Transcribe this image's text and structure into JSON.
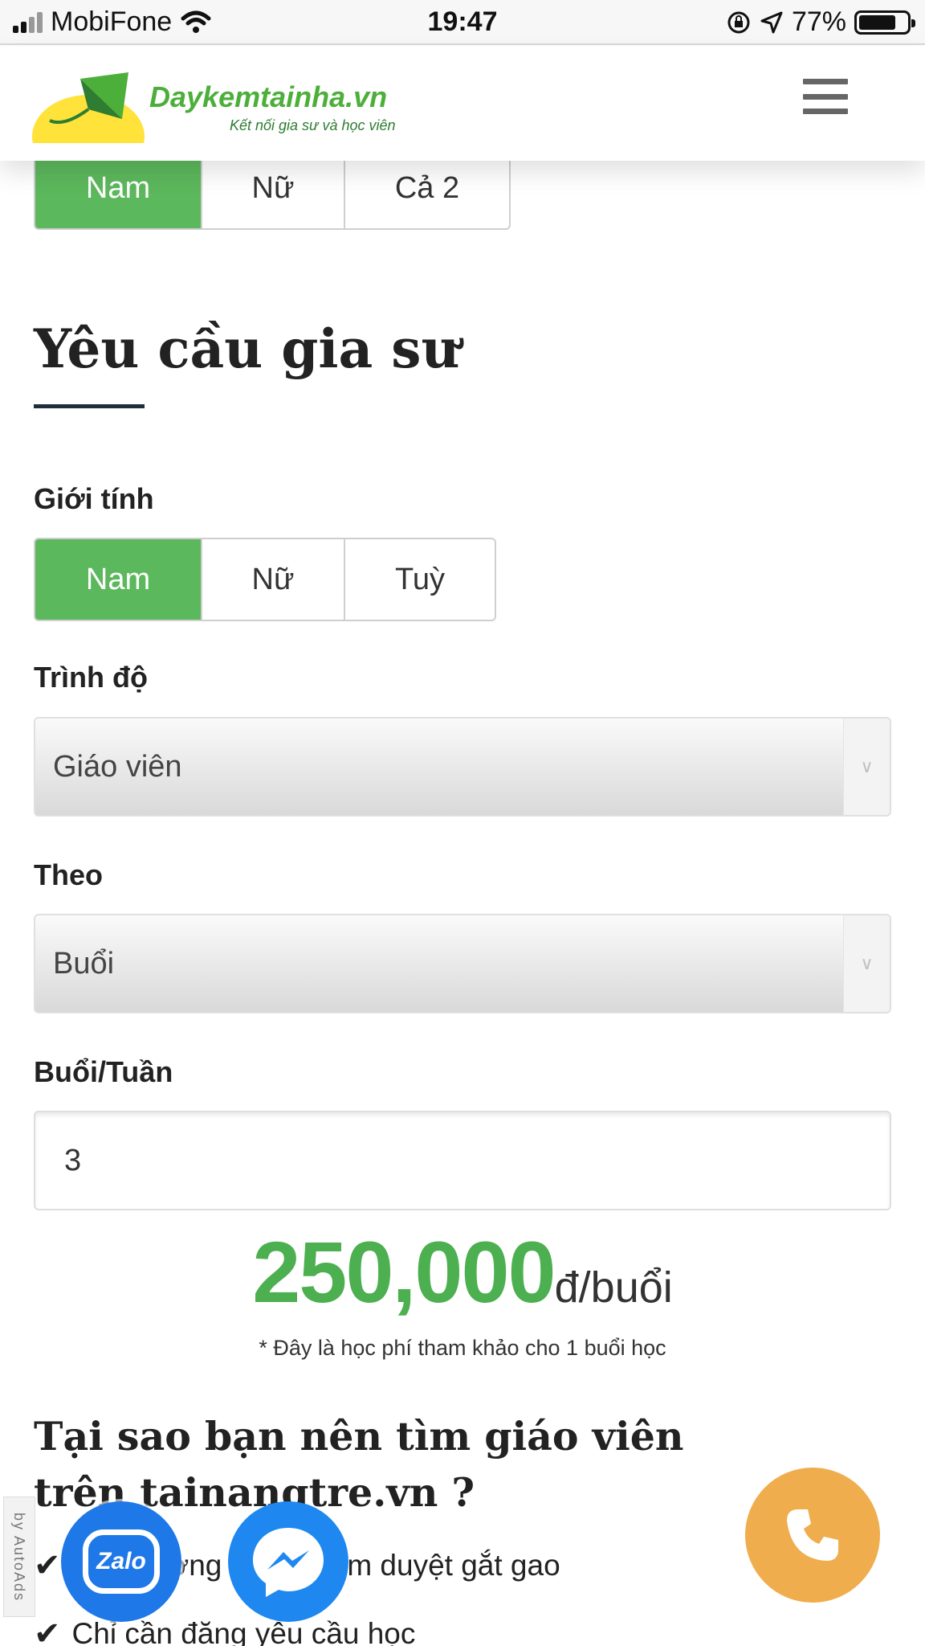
{
  "status_bar": {
    "carrier": "MobiFone",
    "time": "19:47",
    "battery": "77%",
    "battery_level": 0.77
  },
  "header": {
    "logo_title": "Daykemtainha.vn",
    "logo_subtitle": "Kết nối gia sư và học viên",
    "menu_icon": "hamburger-icon"
  },
  "gender_top": {
    "options": [
      "Nam",
      "Nữ",
      "Cả 2"
    ],
    "selected": "Nam"
  },
  "section": {
    "title": "Yêu cầu gia sư"
  },
  "gender": {
    "label": "Giới tính",
    "options": [
      "Nam",
      "Nữ",
      "Tuỳ"
    ],
    "selected": "Nam"
  },
  "level": {
    "label": "Trình độ",
    "value": "Giáo viên"
  },
  "by": {
    "label": "Theo",
    "value": "Buổi"
  },
  "sessions": {
    "label": "Buổi/Tuần",
    "value": "3"
  },
  "price": {
    "amount": "250,000",
    "unit": "đ/buổi",
    "note": "* Đây là học phí tham khảo cho 1 buổi học"
  },
  "why": {
    "title": "Tại sao bạn nên tìm giáo viên trên tainangtre.vn ?",
    "items": [
      "Chất lượng được kiểm duyệt gắt gao",
      "Chỉ cần đăng yêu cầu học"
    ]
  },
  "floating": {
    "zalo_label": "Zalo",
    "autoads_label": "by AutoAds"
  },
  "colors": {
    "active": "#5cb85c",
    "price": "#4caf50",
    "phone": "#f0ad4e",
    "zalo": "#1e78e8",
    "messenger": "#1e88f0"
  }
}
